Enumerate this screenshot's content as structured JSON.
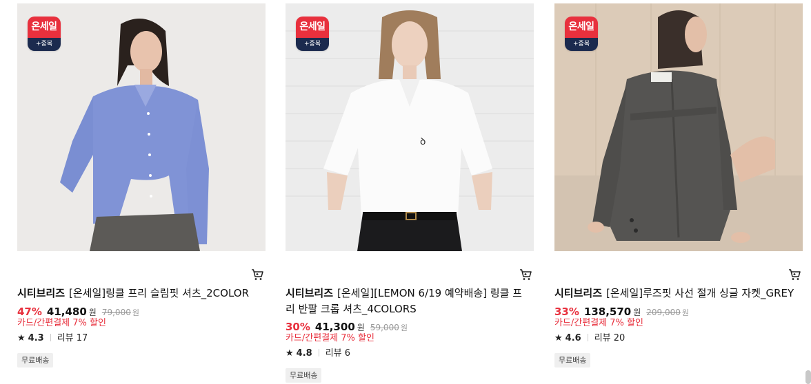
{
  "products": [
    {
      "badge_top": "온세일",
      "badge_bottom": "+중복",
      "brand": "시티브리즈",
      "name": "[온세일]링클 프리 슬림핏 셔츠_2COLOR",
      "discount_pct": "47%",
      "price": "41,480",
      "price_unit": "원",
      "original_price": "79,000",
      "original_unit": "원",
      "card_discount": "카드/간편결제 7% 할인",
      "rating": "4.3",
      "reviews": "리뷰 17",
      "shipping": "무료배송"
    },
    {
      "badge_top": "온세일",
      "badge_bottom": "+중복",
      "brand": "시티브리즈",
      "name": "[온세일][LEMON 6/19 예약배송] 링클 프리 반팔 크롭 셔츠_4COLORS",
      "discount_pct": "30%",
      "price": "41,300",
      "price_unit": "원",
      "original_price": "59,000",
      "original_unit": "원",
      "card_discount": "카드/간편결제 7% 할인",
      "rating": "4.8",
      "reviews": "리뷰 6",
      "shipping": "무료배송"
    },
    {
      "badge_top": "온세일",
      "badge_bottom": "+중복",
      "brand": "시티브리즈",
      "name": "[온세일]루즈핏 사선 절개 싱글 자켓_GREY",
      "discount_pct": "33%",
      "price": "138,570",
      "price_unit": "원",
      "original_price": "209,000",
      "original_unit": "원",
      "card_discount": "카드/간편결제 7% 할인",
      "rating": "4.6",
      "reviews": "리뷰 20",
      "shipping": "무료배송"
    }
  ],
  "colors": {
    "sale_red": "#e8303d",
    "badge_navy": "#1b2a4e"
  },
  "icons": {
    "cart": "cart-icon",
    "star": "star-icon"
  }
}
